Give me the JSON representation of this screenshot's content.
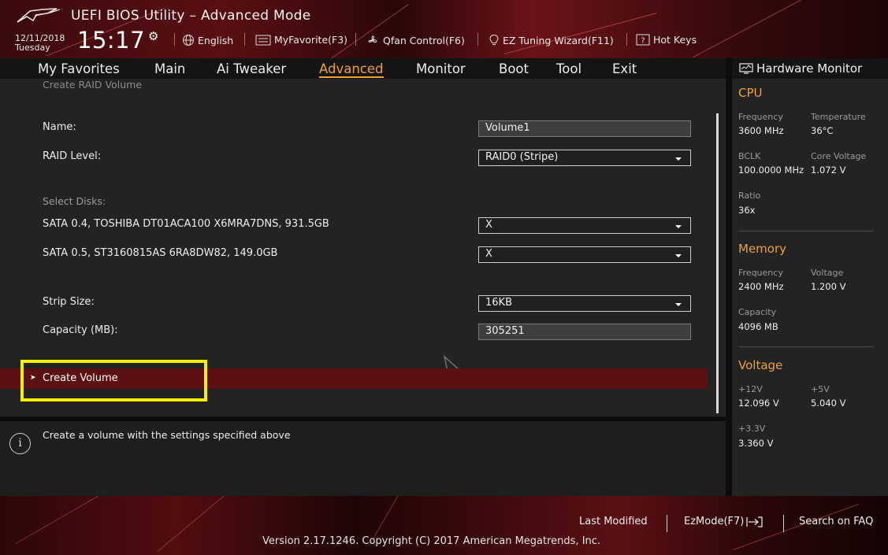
{
  "header": {
    "title": "UEFI BIOS Utility – Advanced Mode",
    "date": "12/11/2018",
    "day": "Tuesday",
    "time": "15:17",
    "toolbar": {
      "language": "English",
      "my_favorite": "MyFavorite(F3)",
      "qfan": "Qfan Control(F6)",
      "ez_tuning": "EZ Tuning Wizard(F11)",
      "hot_keys": "Hot Keys"
    }
  },
  "tabs": [
    "My Favorites",
    "Main",
    "Ai Tweaker",
    "Advanced",
    "Monitor",
    "Boot",
    "Tool",
    "Exit"
  ],
  "active_tab": "Advanced",
  "main": {
    "breadcrumb": "Create RAID Volume",
    "name_label": "Name:",
    "name_value": "Volume1",
    "raid_level_label": "RAID Level:",
    "raid_level_value": "RAID0 (Stripe)",
    "select_disks_label": "Select Disks:",
    "disks": [
      {
        "label": "SATA 0.4, TOSHIBA DT01ACA100 X6MRA7DNS, 931.5GB",
        "value": "X"
      },
      {
        "label": "SATA 0.5, ST3160815AS 6RA8DW82, 149.0GB",
        "value": "X"
      }
    ],
    "strip_size_label": "Strip Size:",
    "strip_size_value": "16KB",
    "capacity_label": "Capacity (MB):",
    "capacity_value": "305251",
    "create_volume_label": "Create Volume"
  },
  "help": {
    "text": "Create a volume with the settings specified above"
  },
  "hardware_monitor": {
    "title": "Hardware Monitor",
    "cpu": {
      "heading": "CPU",
      "frequency_label": "Frequency",
      "frequency": "3600 MHz",
      "temperature_label": "Temperature",
      "temperature": "36°C",
      "bclk_label": "BCLK",
      "bclk": "100.0000 MHz",
      "core_voltage_label": "Core Voltage",
      "core_voltage": "1.072 V",
      "ratio_label": "Ratio",
      "ratio": "36x"
    },
    "memory": {
      "heading": "Memory",
      "frequency_label": "Frequency",
      "frequency": "2400 MHz",
      "voltage_label": "Voltage",
      "voltage": "1.200 V",
      "capacity_label": "Capacity",
      "capacity": "4096 MB"
    },
    "voltage": {
      "heading": "Voltage",
      "v12_label": "+12V",
      "v12": "12.096 V",
      "v5_label": "+5V",
      "v5": "5.040 V",
      "v33_label": "+3.3V",
      "v33": "3.360 V"
    }
  },
  "footer": {
    "last_modified": "Last Modified",
    "ez_mode": "EzMode(F7)",
    "search_faq": "Search on FAQ",
    "version": "Version 2.17.1246. Copyright (C) 2017 American Megatrends, Inc."
  },
  "colors": {
    "accent": "#f1a12e",
    "highlight_box": "#f5f000",
    "selected_row": "#5c1012"
  }
}
